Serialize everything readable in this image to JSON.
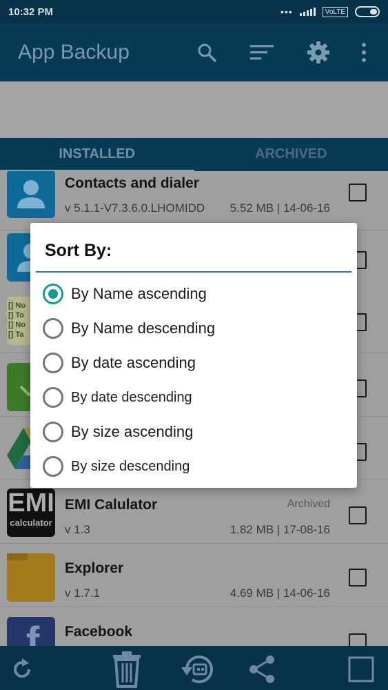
{
  "status_bar": {
    "time": "10:32 PM",
    "network": "VoLTE"
  },
  "app_bar": {
    "title": "App Backup"
  },
  "tabs": [
    {
      "label": "INSTALLED"
    },
    {
      "label": "ARCHIVED"
    }
  ],
  "apps": [
    {
      "name": "Contacts and dialer",
      "version": "v 5.1.1-V7.3.6.0.LHOMIDD",
      "meta": "5.52 MB | 14-06-16",
      "tag": ""
    },
    {
      "name": "",
      "version": "",
      "meta": "",
      "tag": ""
    },
    {
      "name": "",
      "version": "",
      "meta": "",
      "tag": ""
    },
    {
      "name": "",
      "version": "",
      "meta": "",
      "tag": ""
    },
    {
      "name": "",
      "version": "",
      "meta": "",
      "tag": ""
    },
    {
      "name": "EMI Calulator",
      "version": "v 1.3",
      "meta": "1.82 MB | 17-08-16",
      "tag": "Archived"
    },
    {
      "name": "Explorer",
      "version": "v 1.7.1",
      "meta": "4.69 MB | 14-06-16",
      "tag": ""
    },
    {
      "name": "Facebook",
      "version": "",
      "meta": "",
      "tag": ""
    }
  ],
  "todo_icon_lines": [
    "[] No",
    "[] To",
    "[] No",
    "[] Ta"
  ],
  "emi_icon": {
    "big": "EMI",
    "small": "calculator"
  },
  "facebook_icon": {
    "letter": "f"
  },
  "dialog": {
    "title": "Sort By:",
    "options": [
      {
        "label": "By Name ascending",
        "selected": true
      },
      {
        "label": "By Name descending",
        "selected": false
      },
      {
        "label": "By date ascending",
        "selected": false
      },
      {
        "label": "By date descending",
        "selected": false
      },
      {
        "label": "By size ascending",
        "selected": false
      },
      {
        "label": "By size descending",
        "selected": false
      }
    ]
  },
  "colors": {
    "accent": "#179c8f",
    "primary_dark": "#07324a",
    "primary": "#073a55"
  }
}
